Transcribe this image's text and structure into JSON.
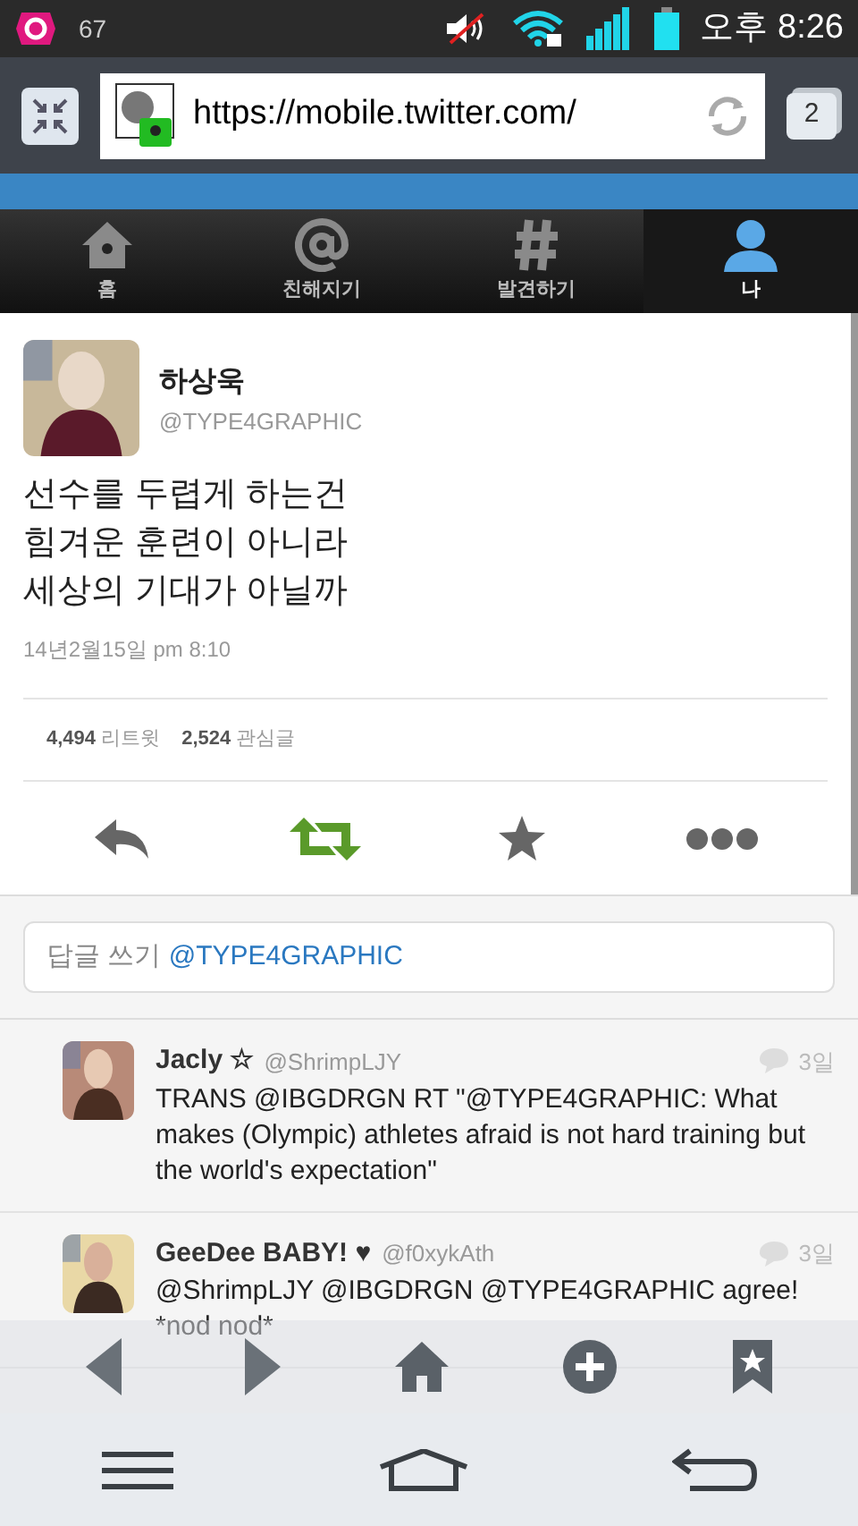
{
  "status_bar": {
    "carrier_count": "67",
    "time": "오후 8:26"
  },
  "browser": {
    "url": "https://mobile.twitter.com/",
    "tab_count": "2"
  },
  "tabs": [
    {
      "label": "홈",
      "kind": "home",
      "selected": false
    },
    {
      "label": "친해지기",
      "kind": "connect",
      "selected": false
    },
    {
      "label": "발견하기",
      "kind": "discover",
      "selected": false
    },
    {
      "label": "나",
      "kind": "me",
      "selected": true
    }
  ],
  "tweet": {
    "name": "하상욱",
    "handle": "@TYPE4GRAPHIC",
    "lines": [
      "선수를 두렵게 하는건",
      "힘겨운 훈련이 아니라",
      "세상의 기대가 아닐까"
    ],
    "timestamp": "14년2월15일 pm 8:10",
    "retweet_count": "4,494",
    "retweet_label": "리트윗",
    "favorite_count": "2,524",
    "favorite_label": "관심글",
    "retweeted": true
  },
  "reply_box": {
    "prefix": "답글 쓰기",
    "mention": "@TYPE4GRAPHIC"
  },
  "replies": [
    {
      "name": "Jacly ☆",
      "handle": "@ShrimpLJY",
      "age": "3일",
      "text": "TRANS @IBGDRGN RT \"@TYPE4GRAPHIC: What makes (Olympic) athletes afraid is not hard training but the world's expectation\""
    },
    {
      "name": "GeeDee BABY! ♥",
      "handle": "@f0xykAth",
      "age": "3일",
      "text": "@ShrimpLJY @IBGDRGN @TYPE4GRAPHIC agree! *nod nod*"
    }
  ]
}
